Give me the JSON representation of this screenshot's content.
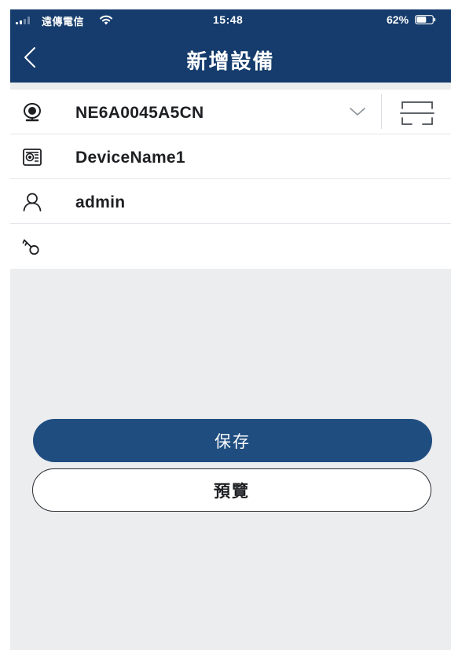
{
  "status_bar": {
    "carrier": "遠傳電信",
    "time": "15:48",
    "battery_pct": "62%",
    "battery_level": 0.62
  },
  "nav": {
    "title": "新增設備",
    "back_icon": "chevron-left-icon"
  },
  "form": {
    "device_id": {
      "icon": "camera-icon",
      "value": "NE6A0045A5CN",
      "dropdown_icon": "chevron-down-icon",
      "scan_icon": "scan-frame-icon"
    },
    "device_name": {
      "icon": "id-card-icon",
      "value": "DeviceName1"
    },
    "username": {
      "icon": "user-icon",
      "value": "admin"
    },
    "password": {
      "icon": "key-icon",
      "value": ""
    }
  },
  "buttons": {
    "save": "保存",
    "preview": "預覽"
  },
  "colors": {
    "header": "#153c6c",
    "primary_button": "#1f4d80",
    "background": "#ecedef"
  }
}
